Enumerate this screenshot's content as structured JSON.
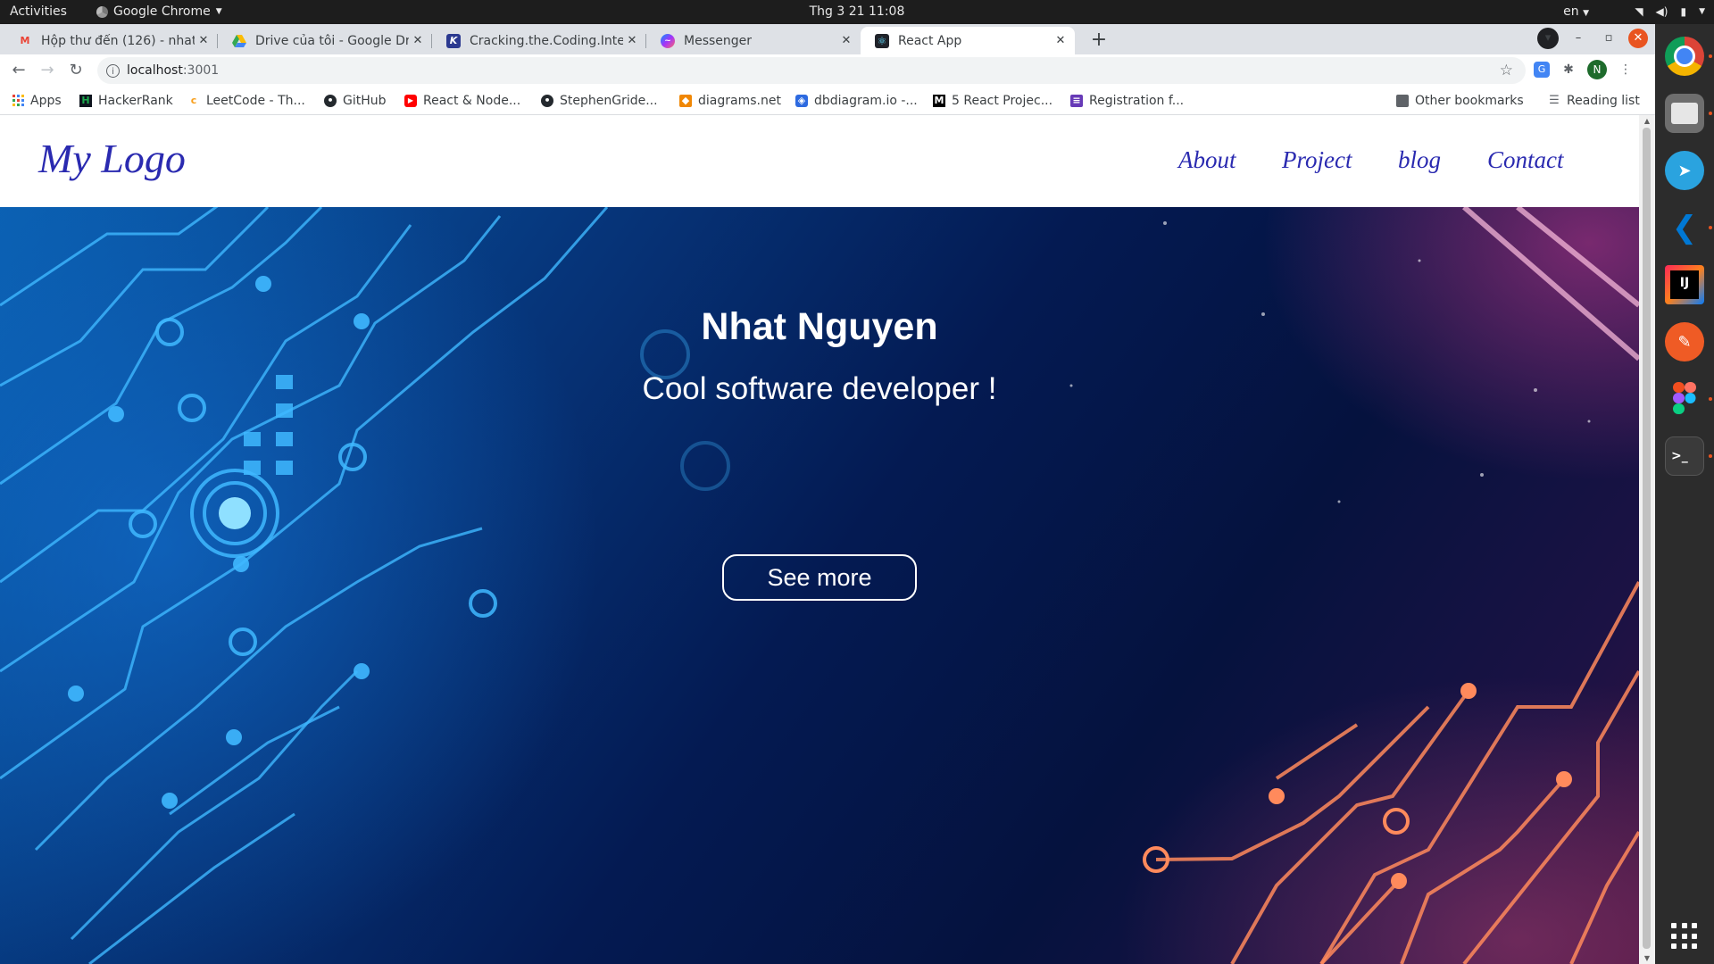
{
  "system_bar": {
    "activities": "Activities",
    "app_name": "Google Chrome",
    "clock": "Thg 3 21  11:08",
    "language": "en"
  },
  "tabs": [
    {
      "title": "Hộp thư đến (126) - nhat...",
      "icon": "gmail-icon",
      "active": false
    },
    {
      "title": "Drive của tôi - Google Drive",
      "icon": "google-drive-icon",
      "active": false
    },
    {
      "title": "Cracking.the.Coding.Inter...",
      "icon": "k-site-icon",
      "active": false
    },
    {
      "title": "Messenger",
      "icon": "messenger-icon",
      "active": false
    },
    {
      "title": "React App",
      "icon": "react-icon",
      "active": true
    }
  ],
  "toolbar": {
    "url_host": "localhost",
    "url_port": ":3001"
  },
  "bookmarks": [
    {
      "label": "Apps",
      "icon": "apps-grid-icon",
      "color": "#4285f4"
    },
    {
      "label": "HackerRank",
      "icon": "hackerrank-icon",
      "color": "#1ba94c"
    },
    {
      "label": "LeetCode - Th...",
      "icon": "leetcode-icon",
      "color": "#f89f1b"
    },
    {
      "label": "GitHub",
      "icon": "github-icon",
      "color": "#24292e"
    },
    {
      "label": "React & Node...",
      "icon": "youtube-icon",
      "color": "#ff0000"
    },
    {
      "label": "StephenGride...",
      "icon": "github-icon",
      "color": "#24292e"
    },
    {
      "label": "diagrams.net",
      "icon": "drawio-icon",
      "color": "#f08705"
    },
    {
      "label": "dbdiagram.io -...",
      "icon": "dbdiagram-icon",
      "color": "#2d6ae0"
    },
    {
      "label": "5 React Projec...",
      "icon": "medium-icon",
      "color": "#000000"
    },
    {
      "label": "Registration f...",
      "icon": "forms-icon",
      "color": "#673ab7"
    }
  ],
  "bookmarks_right": {
    "other": "Other bookmarks",
    "reading": "Reading list"
  },
  "site": {
    "logo": "My Logo",
    "nav": [
      "About",
      "Project",
      "blog",
      "Contact"
    ],
    "hero_name": "Nhat Nguyen",
    "hero_tagline": "Cool software developer !",
    "cta": "See more"
  },
  "colors": {
    "nav_text": "#2a2ab0",
    "hero_dark": "#041a52",
    "circuit_blue": "#3fb8ff",
    "circuit_orange": "#ff8a5c",
    "ubuntu_orange": "#e95420"
  },
  "dock": [
    "chrome-icon",
    "files-icon",
    "telegram-icon",
    "vscode-icon",
    "intellij-icon",
    "postman-icon",
    "figma-icon",
    "terminal-icon"
  ]
}
